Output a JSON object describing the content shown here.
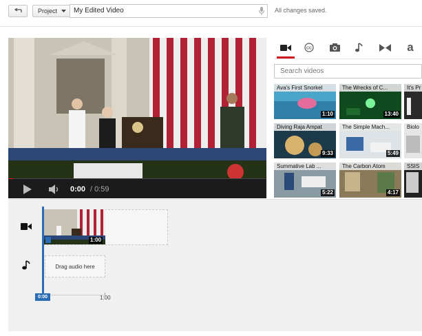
{
  "toolbar": {
    "project_label": "Project",
    "title_value": "My Edited Video",
    "save_status": "All changes saved."
  },
  "player": {
    "time_current": "0:00",
    "time_total": "/ 0:59",
    "progress": 0.0
  },
  "panel": {
    "tabs": [
      {
        "icon": "video-camera-icon",
        "active": true
      },
      {
        "icon": "closed-captions-icon",
        "active": false
      },
      {
        "icon": "photo-camera-icon",
        "active": false
      },
      {
        "icon": "music-note-icon",
        "active": false
      },
      {
        "icon": "transitions-icon",
        "active": false
      },
      {
        "icon": "text-icon",
        "label": "a",
        "active": false
      }
    ],
    "search_placeholder": "Search videos",
    "videos": [
      {
        "title": "Ava's First Snorkel",
        "duration": "1:10"
      },
      {
        "title": "The Wrecks of C...",
        "duration": "13:40"
      },
      {
        "title": "It's Pr",
        "duration": ""
      },
      {
        "title": "Diving Raja Ampat",
        "duration": "9:33"
      },
      {
        "title": "The Simple Mach...",
        "duration": "5:49"
      },
      {
        "title": "Biolo",
        "duration": ""
      },
      {
        "title": "Summative Lab ...",
        "duration": "5:22"
      },
      {
        "title": "The Carbon Atom",
        "duration": "4:17"
      },
      {
        "title": "SSIS",
        "duration": ""
      }
    ]
  },
  "timeline": {
    "clip_duration": "1:00",
    "audio_placeholder": "Drag audio here",
    "playhead_time": "0:00",
    "ruler_end": "1:00"
  },
  "colors": {
    "accent_red": "#cc181e",
    "playhead_blue": "#2a6db5"
  }
}
